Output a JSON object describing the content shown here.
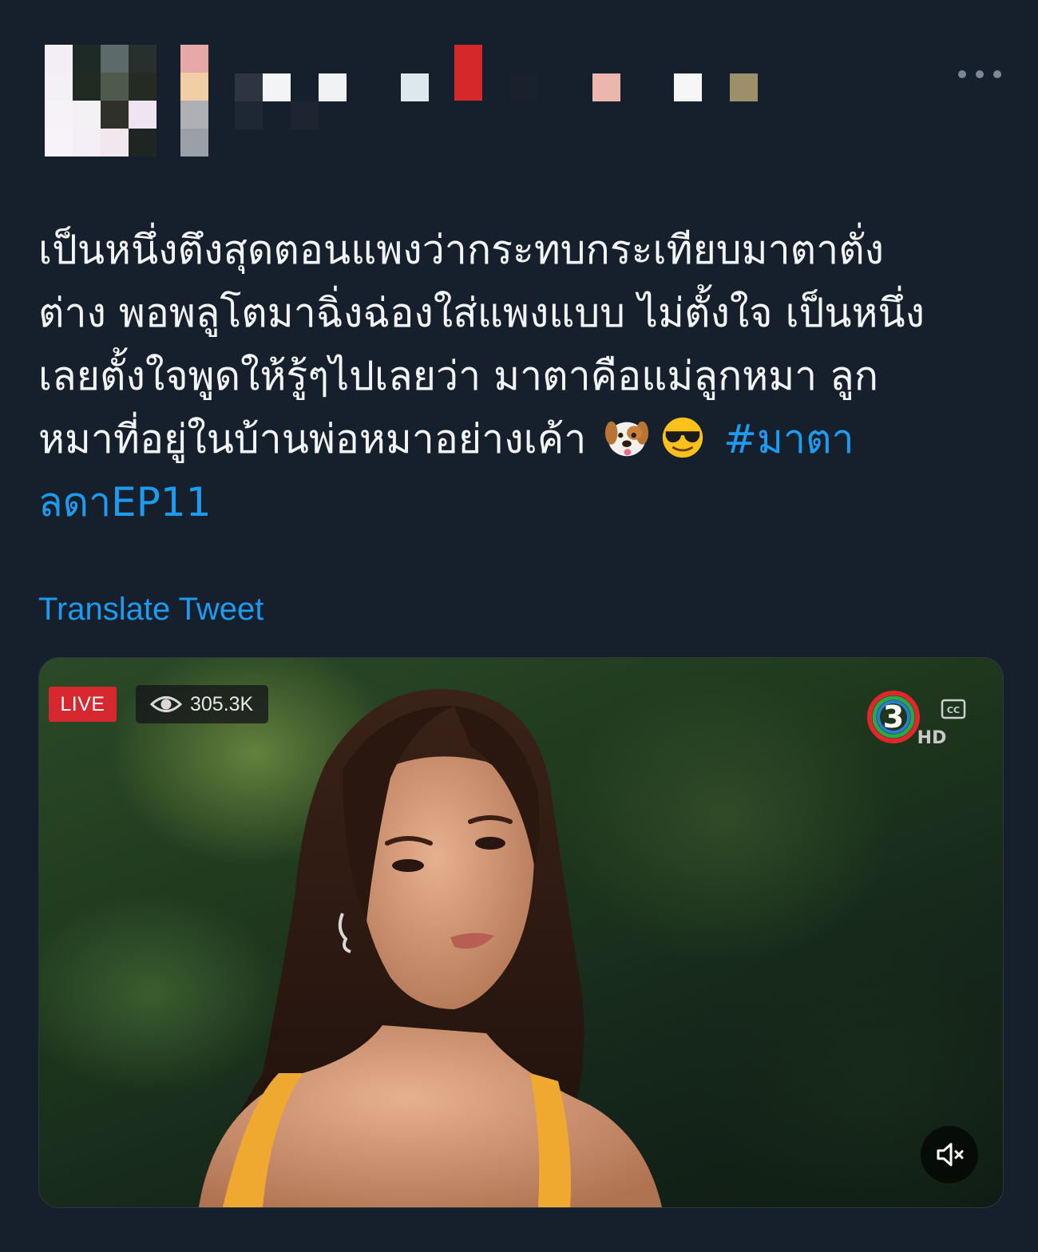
{
  "tweet": {
    "text_lines": [
      "เป็นหนึ่งตึงสุดตอนแพงว่ากระทบกระเทียบมาตาตั่ง",
      "ต่าง พอพลูโตมาฉิ่งฉ่องใส่แพงแบบ ไม่ตั้งใจ เป็นหนึ่ง",
      "เลยตั้งใจพูดให้รู้ๆไปเลยว่า มาตาคือแม่ลูกหมา ลูก",
      "หมาที่อยู่ในบ้านพ่อหมาอย่างเค้า"
    ],
    "emojis": [
      "dog-face-emoji",
      "sunglasses-face-emoji"
    ],
    "hashtag_part1": "#มาตา",
    "hashtag_part2": "ลดาEP11",
    "translate_label": "Translate Tweet"
  },
  "video": {
    "live_label": "LIVE",
    "view_count": "305.3K",
    "channel_logo_text": "3",
    "channel_logo_hd": "HD",
    "cc_label": "CC"
  },
  "colors": {
    "background": "#16202d",
    "link": "#1d9bf0",
    "live_red": "#d7282f"
  }
}
